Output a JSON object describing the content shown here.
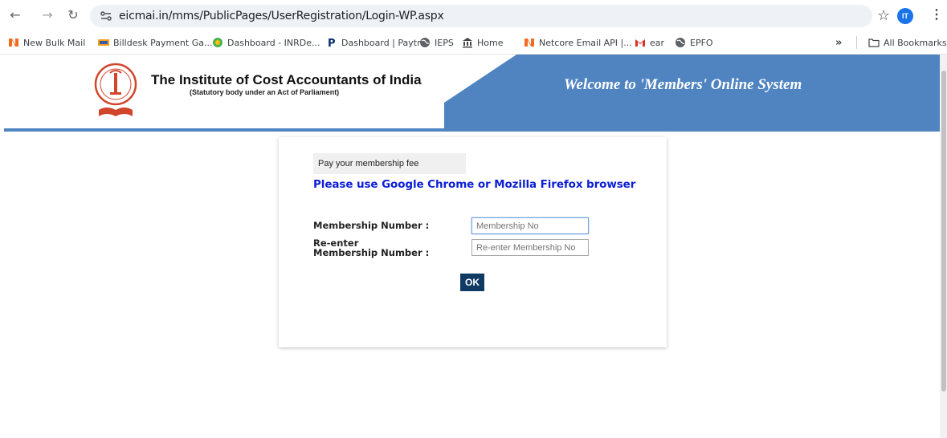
{
  "browser": {
    "url": "eicmai.in/mms/PublicPages/UserRegistration/Login-WP.aspx",
    "avatar_initials": "IT",
    "bookmarks": [
      {
        "label": "New Bulk Mail",
        "icon": "netcore-icon"
      },
      {
        "label": "Billdesk Payment Ga...",
        "icon": "billdesk-icon"
      },
      {
        "label": "Dashboard - INRDe...",
        "icon": "inrdeals-icon"
      },
      {
        "label": "Dashboard | Paytm",
        "icon": "paytm-icon"
      },
      {
        "label": "IEPS",
        "icon": "globe-icon"
      },
      {
        "label": "Home",
        "icon": "bank-icon"
      },
      {
        "label": "Netcore Email API |...",
        "icon": "netcore-icon"
      },
      {
        "label": "ear",
        "icon": "gmail-icon"
      },
      {
        "label": "EPFO",
        "icon": "globe-icon"
      }
    ],
    "more_bookmarks": "»",
    "all_bookmarks": "All Bookmarks"
  },
  "header": {
    "org_name": "The Institute of Cost Accountants of India",
    "org_subtitle": "(Statutory body under an Act of Parliament)",
    "welcome": "Welcome to 'Members' Online System"
  },
  "form": {
    "pay_label": "Pay your membership fee",
    "browser_note": "Please use Google Chrome or Mozilla Firefox browser",
    "membership_label": "Membership Number :",
    "membership_placeholder": "Membership No",
    "reenter_label_line1": "Re-enter",
    "reenter_label_line2": "Membership Number :",
    "reenter_placeholder": "Re-enter Membership No",
    "ok_label": "OK"
  },
  "colors": {
    "header_blue": "#4f84c1",
    "note_blue": "#0c1fd6",
    "ok_button": "#0f3a63"
  }
}
